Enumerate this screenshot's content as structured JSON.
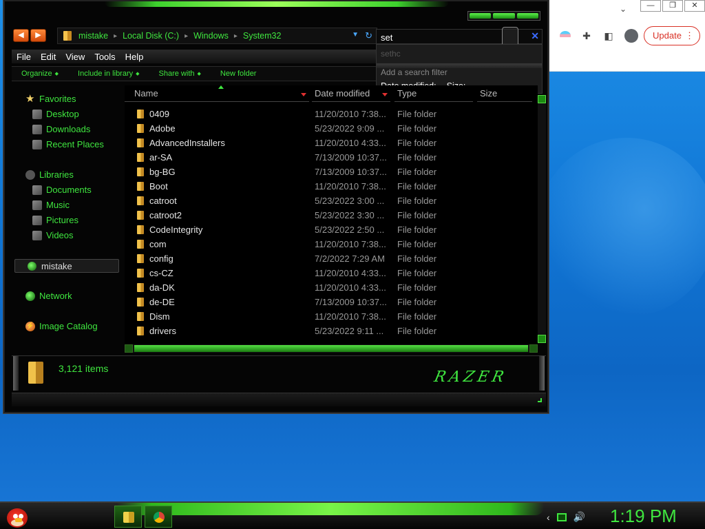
{
  "chrome": {
    "update_label": "Update",
    "caption_min": "—",
    "caption_restore": "❐",
    "caption_close": "✕"
  },
  "explorer": {
    "breadcrumbs": [
      "mistake",
      "Local Disk (C:)",
      "Windows",
      "System32"
    ],
    "search": {
      "value": "set",
      "suggestion": "sethc",
      "filter_prompt": "Add a search filter",
      "filter_options": [
        "Date modified:",
        "Size:"
      ]
    },
    "menu": [
      "File",
      "Edit",
      "View",
      "Tools",
      "Help"
    ],
    "commands": [
      "Organize",
      "Include in library",
      "Share with",
      "New folder"
    ],
    "nav": {
      "favorites": "Favorites",
      "desktop": "Desktop",
      "downloads": "Downloads",
      "recent": "Recent Places",
      "libraries": "Libraries",
      "documents": "Documents",
      "music": "Music",
      "pictures": "Pictures",
      "videos": "Videos",
      "mistake": "mistake",
      "network": "Network",
      "image_catalog": "Image Catalog"
    },
    "columns": {
      "name": "Name",
      "date": "Date modified",
      "type": "Type",
      "size": "Size"
    },
    "files": [
      {
        "name": "0409",
        "date": "11/20/2010 7:38...",
        "type": "File folder"
      },
      {
        "name": "Adobe",
        "date": "5/23/2022 9:09 ...",
        "type": "File folder"
      },
      {
        "name": "AdvancedInstallers",
        "date": "11/20/2010 4:33...",
        "type": "File folder"
      },
      {
        "name": "ar-SA",
        "date": "7/13/2009 10:37...",
        "type": "File folder"
      },
      {
        "name": "bg-BG",
        "date": "7/13/2009 10:37...",
        "type": "File folder"
      },
      {
        "name": "Boot",
        "date": "11/20/2010 7:38...",
        "type": "File folder"
      },
      {
        "name": "catroot",
        "date": "5/23/2022 3:00 ...",
        "type": "File folder"
      },
      {
        "name": "catroot2",
        "date": "5/23/2022 3:30 ...",
        "type": "File folder"
      },
      {
        "name": "CodeIntegrity",
        "date": "5/23/2022 2:50 ...",
        "type": "File folder"
      },
      {
        "name": "com",
        "date": "11/20/2010 7:38...",
        "type": "File folder"
      },
      {
        "name": "config",
        "date": "7/2/2022 7:29 AM",
        "type": "File folder"
      },
      {
        "name": "cs-CZ",
        "date": "11/20/2010 4:33...",
        "type": "File folder"
      },
      {
        "name": "da-DK",
        "date": "11/20/2010 4:33...",
        "type": "File folder"
      },
      {
        "name": "de-DE",
        "date": "7/13/2009 10:37...",
        "type": "File folder"
      },
      {
        "name": "Dism",
        "date": "11/20/2010 7:38...",
        "type": "File folder"
      },
      {
        "name": "drivers",
        "date": "5/23/2022 9:11 ...",
        "type": "File folder"
      }
    ],
    "item_count": "3,121 items",
    "logo_text": "RAZER"
  },
  "taskbar": {
    "clock": "1:19 PM"
  },
  "colors": {
    "accent_green": "#3fe63f",
    "chrome_update": "#d93025"
  }
}
